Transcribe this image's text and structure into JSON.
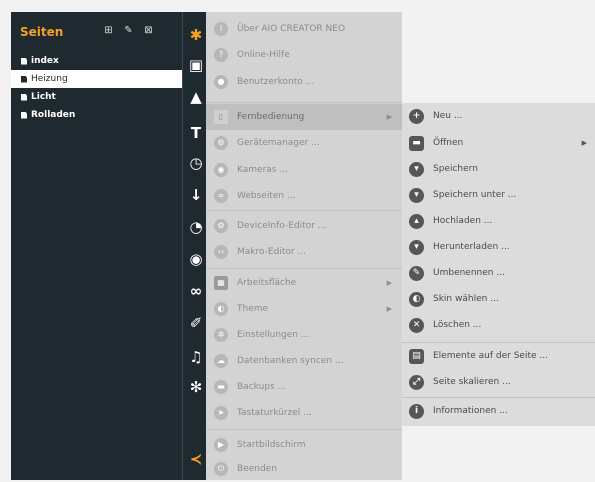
{
  "sidebar": {
    "title": "Seiten",
    "pages": [
      {
        "label": "index",
        "selected": false
      },
      {
        "label": "Heizung",
        "selected": true
      },
      {
        "label": "Licht",
        "selected": false
      },
      {
        "label": "Rolladen",
        "selected": false
      }
    ]
  },
  "main_menu": {
    "items": [
      {
        "label": "Über AIO CREATOR NEO",
        "icon": "info-icon"
      },
      {
        "label": "Online-Hilfe",
        "icon": "help-icon"
      },
      {
        "label": "Benutzerkonto ...",
        "icon": "user-icon"
      },
      {
        "label": "Fernbedienung",
        "icon": "remote-icon",
        "submenu": true,
        "active": true
      },
      {
        "label": "Gerätemanager ...",
        "icon": "device-manager-icon"
      },
      {
        "label": "Kameras ...",
        "icon": "camera-icon"
      },
      {
        "label": "Webseiten ...",
        "icon": "web-icon"
      },
      {
        "label": "DeviceInfo-Editor ...",
        "icon": "deviceinfo-icon"
      },
      {
        "label": "Makro-Editor ...",
        "icon": "macro-icon"
      },
      {
        "label": "Arbeitsfläche",
        "icon": "workspace-icon",
        "submenu": true
      },
      {
        "label": "Theme",
        "icon": "theme-icon",
        "submenu": true
      },
      {
        "label": "Einstellungen ...",
        "icon": "settings-icon"
      },
      {
        "label": "Datenbanken syncen ...",
        "icon": "cloud-sync-icon"
      },
      {
        "label": "Backups ...",
        "icon": "backup-folder-icon"
      },
      {
        "label": "Tastaturkürzel ...",
        "icon": "keyboard-shortcut-icon"
      },
      {
        "label": "Startbildschirm",
        "icon": "start-screen-icon"
      },
      {
        "label": "Beenden",
        "icon": "power-icon"
      }
    ]
  },
  "sub_menu": {
    "items": [
      {
        "label": "Neu ...",
        "icon": "plus-icon"
      },
      {
        "label": "Öffnen",
        "icon": "folder-open-icon",
        "submenu": true
      },
      {
        "label": "Speichern",
        "icon": "save-icon"
      },
      {
        "label": "Speichern unter ...",
        "icon": "save-as-icon"
      },
      {
        "label": "Hochladen ...",
        "icon": "upload-icon"
      },
      {
        "label": "Herunterladen ...",
        "icon": "download-icon"
      },
      {
        "label": "Umbenennen ...",
        "icon": "rename-icon"
      },
      {
        "label": "Skin wählen ...",
        "icon": "skin-icon"
      },
      {
        "label": "Löschen ...",
        "icon": "delete-icon"
      },
      {
        "label": "Elemente auf der Seite ...",
        "icon": "elements-icon"
      },
      {
        "label": "Seite skalieren ...",
        "icon": "scale-icon"
      },
      {
        "label": "Informationen ...",
        "icon": "info-icon"
      }
    ]
  },
  "colors": {
    "sidebar_bg": "#1f2a30",
    "accent": "#f4a125",
    "menu_bg": "#d3d3d3",
    "submenu_bg": "#dcdcdc"
  }
}
